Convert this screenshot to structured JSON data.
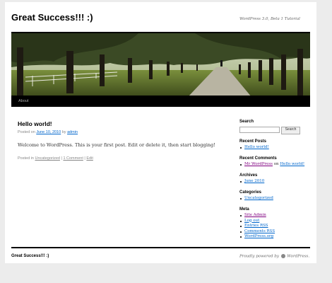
{
  "header": {
    "site_title": "Great Success!!! :)",
    "site_description": "WordPress 3.0, Beta 1 Tutorial"
  },
  "nav": {
    "items": [
      {
        "label": "About"
      }
    ]
  },
  "post": {
    "title": "Hello world!",
    "meta": {
      "posted_on": "Posted on",
      "date": "June 10, 2010",
      "by": "by",
      "author": "admin"
    },
    "content": "Welcome to WordPress. This is your first post. Edit or delete it, then start blogging!",
    "utility": {
      "posted_in": "Posted in",
      "category": "Uncategorized",
      "sep1": "|",
      "comments": "1 Comment",
      "sep2": "|",
      "edit": "Edit"
    }
  },
  "sidebar": {
    "search": {
      "title": "Search",
      "button_label": "Search"
    },
    "recent_posts": {
      "title": "Recent Posts",
      "items": [
        "Hello world!"
      ]
    },
    "recent_comments": {
      "title": "Recent Comments",
      "items": [
        {
          "author": "Mr WordPress",
          "on": "on",
          "post": "Hello world!"
        }
      ]
    },
    "archives": {
      "title": "Archives",
      "items": [
        "June 2010"
      ]
    },
    "categories": {
      "title": "Categories",
      "items": [
        "Uncategorized"
      ]
    },
    "meta": {
      "title": "Meta",
      "items": [
        "Site Admin",
        "Log out",
        "Entries RSS",
        "Comments RSS",
        "WordPress.org"
      ]
    }
  },
  "footer": {
    "site_title": "Great Success!!! :)",
    "credit_prefix": "Proudly powered by",
    "credit_link": "WordPress."
  },
  "colors": {
    "link": "#0066cc",
    "visited_link": "#800080",
    "header_bar": "#000000",
    "page_background": "#ececec"
  }
}
